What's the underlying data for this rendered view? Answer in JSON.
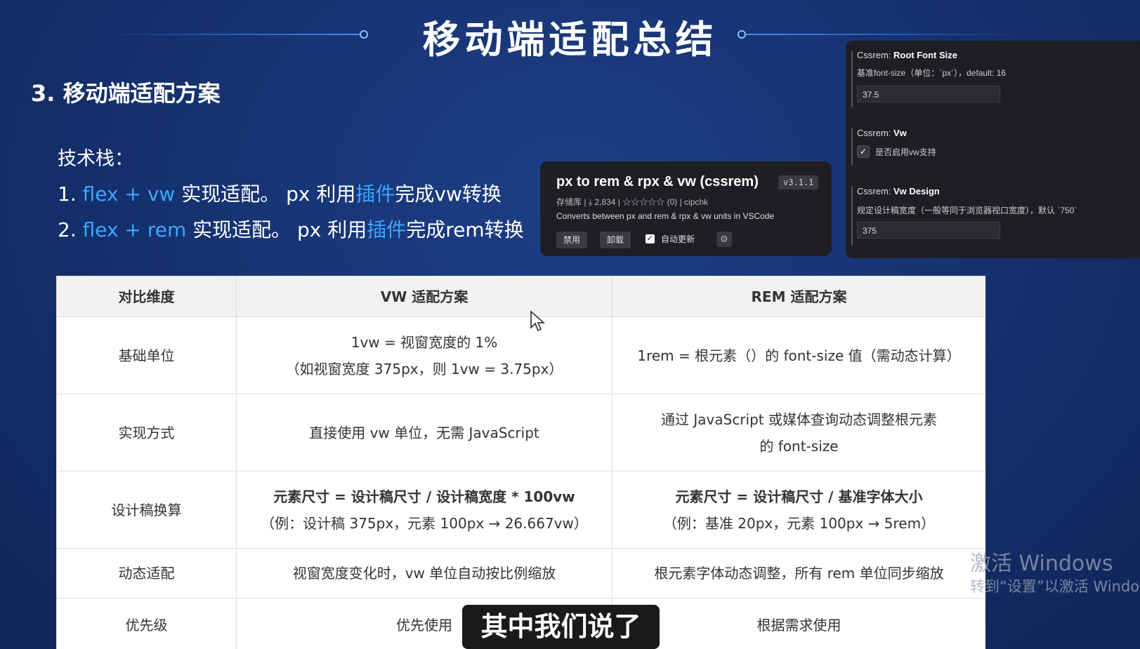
{
  "slide": {
    "title": "移动端适配总结",
    "section": "3. 移动端适配方案",
    "stack_label": "技术栈：",
    "lines": [
      {
        "num": "1. ",
        "hl": "flex + vw",
        "mid": " 实现适配。   px 利用",
        "hl2": "插件",
        "end": "完成vw转换"
      },
      {
        "num": "2. ",
        "hl": "flex + rem",
        "mid": " 实现适配。   px 利用",
        "hl2": "插件",
        "end": "完成rem转换"
      }
    ]
  },
  "plugin": {
    "name": "px to rem & rpx & vw (cssrem)",
    "version": "v3.1.1",
    "meta": "存储库  |  ⤓ 2,834  |  ☆☆☆☆☆ (0)  |  cipchk",
    "desc": "Converts between px and rem & rpx & vw units in VSCode",
    "btn_disable": "禁用",
    "btn_uninstall": "卸载",
    "auto_update": "自动更新"
  },
  "settings": {
    "root_prefix": "Cssrem: ",
    "root_title": "Root Font Size",
    "root_desc": "基准font-size（单位：`px`），default: 16",
    "root_value": "37.5",
    "vw_prefix": "Cssrem: ",
    "vw_title": "Vw",
    "vw_desc": "是否启用vw支持",
    "design_prefix": "Cssrem: ",
    "design_title": "Vw Design",
    "design_desc": "规定设计稿宽度（一般等同于浏览器视口宽度），默认 `750`",
    "design_value": "375"
  },
  "table": {
    "headers": [
      "对比维度",
      "VW 适配方案",
      "REM 适配方案"
    ],
    "rows": [
      {
        "dim": "基础单位",
        "vw1": "1vw = 视窗宽度的 1%",
        "vw2": "（如视窗宽度 375px，则 1vw = 3.75px）",
        "rem1": "1rem = 根元素（）的 font-size 值（需动态计算）",
        "rem2": ""
      },
      {
        "dim": "实现方式",
        "vw1": "直接使用 vw 单位，无需 JavaScript",
        "vw2": "",
        "rem1": "通过 JavaScript 或媒体查询动态调整根元素",
        "rem2": "的 font-size"
      },
      {
        "dim": "设计稿换算",
        "vw1": "元素尺寸 = 设计稿尺寸 / 设计稿宽度 * 100vw",
        "vw2": "（例：设计稿 375px，元素 100px → 26.667vw）",
        "rem1": "元素尺寸 = 设计稿尺寸 / 基准字体大小",
        "rem2": "（例：基准 20px，元素 100px → 5rem）"
      },
      {
        "dim": "动态适配",
        "vw1": "视窗宽度变化时，vw 单位自动按比例缩放",
        "vw2": "",
        "rem1": "根元素字体动态调整，所有 rem 单位同步缩放",
        "rem2": ""
      },
      {
        "dim": "优先级",
        "vw1": "优先使用",
        "vw2": "",
        "rem1": "根据需求使用",
        "rem2": ""
      }
    ]
  },
  "caption": "其中我们说了",
  "watermark": {
    "line1": "激活 Windows",
    "line2": "转到“设置”以激活 Windo"
  }
}
